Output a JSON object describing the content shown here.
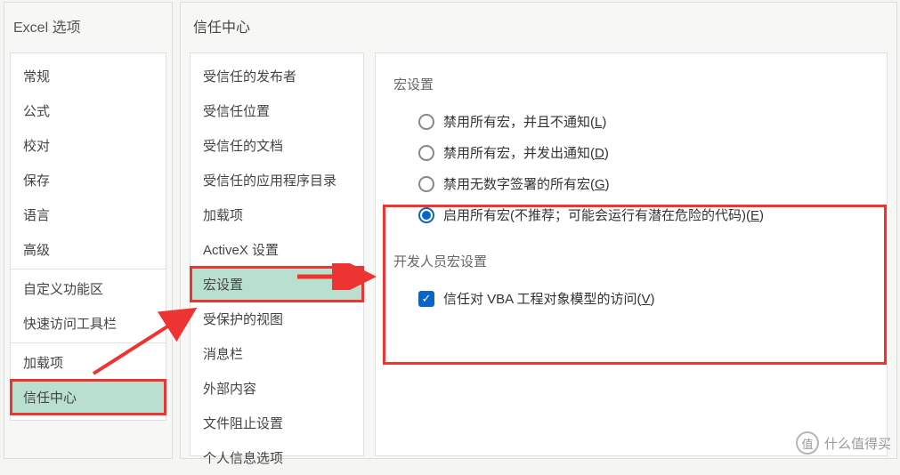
{
  "left": {
    "title": "Excel 选项",
    "items": [
      "常规",
      "公式",
      "校对",
      "保存",
      "语言",
      "高级"
    ],
    "items2": [
      "自定义功能区",
      "快速访问工具栏"
    ],
    "items3": [
      "加载项",
      "信任中心"
    ],
    "selected": "信任中心"
  },
  "mid": {
    "title": "信任中心",
    "items": [
      "受信任的发布者",
      "受信任位置",
      "受信任的文档",
      "受信任的应用程序目录",
      "加载项",
      "ActiveX 设置",
      "宏设置",
      "受保护的视图",
      "消息栏",
      "外部内容",
      "文件阻止设置",
      "个人信息选项"
    ],
    "selected": "宏设置"
  },
  "right": {
    "section1": "宏设置",
    "opts": [
      {
        "label": "禁用所有宏，并且不通知(",
        "accel": "L",
        "tail": ")"
      },
      {
        "label": "禁用所有宏，并发出通知(",
        "accel": "D",
        "tail": ")"
      },
      {
        "label": "禁用无数字签署的所有宏(",
        "accel": "G",
        "tail": ")"
      },
      {
        "label": "启用所有宏(不推荐；可能会运行有潜在危险的代码)(",
        "accel": "E",
        "tail": ")"
      }
    ],
    "selectedOpt": 3,
    "section2": "开发人员宏设置",
    "chk": {
      "label": "信任对 VBA 工程对象模型的访问(",
      "accel": "V",
      "tail": ")"
    }
  },
  "watermark": {
    "badge": "值",
    "text": "什么值得买"
  }
}
